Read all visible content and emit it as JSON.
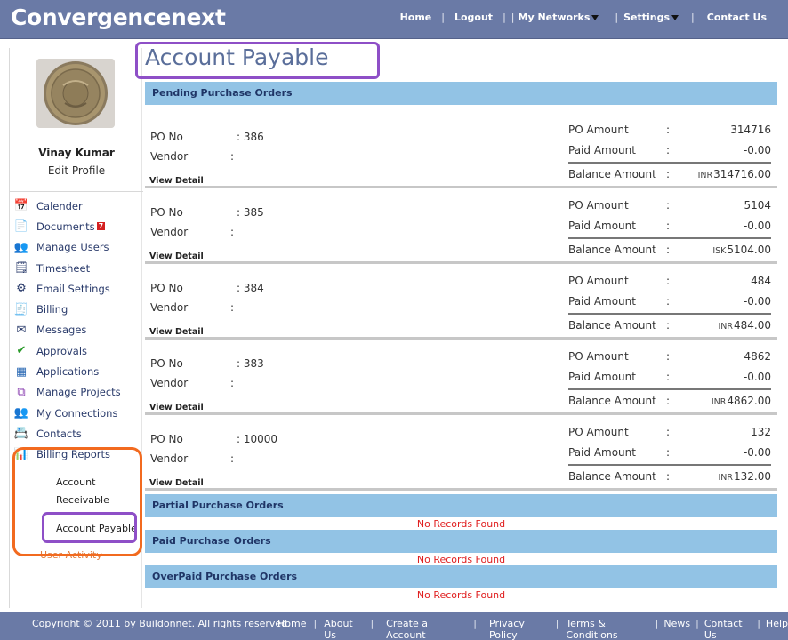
{
  "header": {
    "brand": "Convergencenext",
    "nav": [
      {
        "label": "Home"
      },
      {
        "label": "Logout"
      },
      {
        "label": "My Networks",
        "dropdown": true
      },
      {
        "label": "Settings",
        "dropdown": true
      },
      {
        "label": "Contact Us"
      }
    ]
  },
  "profile": {
    "name": "Vinay Kumar",
    "edit_label": "Edit Profile"
  },
  "menu": [
    {
      "label": "Calender",
      "icon": "calendar-icon",
      "glyph": "📅"
    },
    {
      "label": "Documents",
      "icon": "documents-icon",
      "glyph": "📄",
      "badge": "7"
    },
    {
      "label": "Manage Users",
      "icon": "users-icon",
      "glyph": "👥"
    },
    {
      "label": "Timesheet",
      "icon": "timesheet-icon",
      "glyph": "🗒"
    },
    {
      "label": "Email Settings",
      "icon": "email-settings-icon",
      "glyph": "⚙"
    },
    {
      "label": "Billing",
      "icon": "billing-icon",
      "glyph": "🧾"
    },
    {
      "label": "Messages",
      "icon": "messages-icon",
      "glyph": "✉"
    },
    {
      "label": "Approvals",
      "icon": "approvals-icon",
      "glyph": "✔"
    },
    {
      "label": "Applications",
      "icon": "applications-icon",
      "glyph": "▦"
    },
    {
      "label": "Manage Projects",
      "icon": "projects-icon",
      "glyph": "⧉"
    },
    {
      "label": "My Connections",
      "icon": "connections-icon",
      "glyph": "👥"
    },
    {
      "label": "Contacts",
      "icon": "contacts-icon",
      "glyph": "📇"
    },
    {
      "label": "Billing Reports",
      "icon": "billing-reports-icon",
      "glyph": "📊"
    }
  ],
  "billing_reports_sub": {
    "receivable_line1": "Account",
    "receivable_line2": "Receivable",
    "payable": "Account Payable"
  },
  "user_activity": "User Activity",
  "page_title": "Account Payable",
  "sections": {
    "pending": "Pending Purchase Orders",
    "partial": "Partial Purchase Orders",
    "paid": "Paid Purchase Orders",
    "overpaid": "OverPaid Purchase Orders",
    "no_records": "No Records Found"
  },
  "labels": {
    "po_no": "PO No",
    "vendor": "Vendor",
    "view_detail": "View Detail",
    "po_amount": "PO Amount",
    "paid_amount": "Paid Amount",
    "balance_amount": "Balance Amount",
    "colon": ":"
  },
  "purchase_orders": [
    {
      "po_no": ": 386",
      "po_amount": "314716",
      "paid_amount": "-0.00",
      "currency": "INR",
      "balance": "314716.00"
    },
    {
      "po_no": ": 385",
      "po_amount": "5104",
      "paid_amount": "-0.00",
      "currency": "ISK",
      "balance": "5104.00"
    },
    {
      "po_no": ": 384",
      "po_amount": "484",
      "paid_amount": "-0.00",
      "currency": "INR",
      "balance": "484.00"
    },
    {
      "po_no": ": 383",
      "po_amount": "4862",
      "paid_amount": "-0.00",
      "currency": "INR",
      "balance": "4862.00"
    },
    {
      "po_no": ": 10000",
      "po_amount": "132",
      "paid_amount": "-0.00",
      "currency": "INR",
      "balance": "132.00"
    }
  ],
  "footer": {
    "copyright": "Copyright © 2011 by Buildonnet. All rights reserved.",
    "links": [
      "Home",
      "About Us",
      "Create a Account",
      "Privacy Policy",
      "Terms & Conditions",
      "News",
      "Contact Us",
      "Help"
    ]
  },
  "colors": {
    "header_bg": "#6a7aa6",
    "section_bar": "#92c3e5",
    "highlight_orange": "#f26a1f",
    "highlight_purple": "#8e4fc7",
    "no_records": "#e02020"
  }
}
